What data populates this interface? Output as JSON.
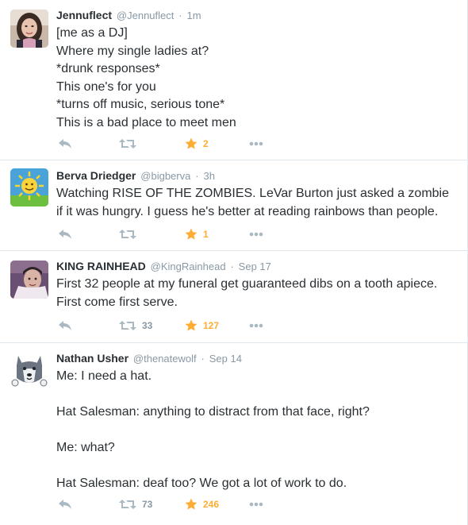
{
  "colors": {
    "text": "#292f33",
    "muted": "#8899a6",
    "favorite": "#ffac33",
    "divider": "#e1e8ed"
  },
  "tweets": [
    {
      "fullname": "Jennuflect",
      "username": "@Jennuflect",
      "time": "1m",
      "lines": [
        "[me as a DJ]",
        "Where my single ladies at?",
        "*drunk responses*",
        "This one's for you",
        "*turns off music, serious tone*",
        "This is a bad place to meet men"
      ],
      "retweets": "",
      "favorites": "2",
      "avatar_icon": "woman-avatar-icon"
    },
    {
      "fullname": "Berva Driedger",
      "username": "@bigberva",
      "time": "3h",
      "lines": [
        "Watching RISE OF THE ZOMBIES. LeVar Burton just asked a zombie",
        "if it was hungry. I guess he's better at reading rainbows than people."
      ],
      "retweets": "",
      "favorites": "1",
      "avatar_icon": "sun-avatar-icon"
    },
    {
      "fullname": "KING RAINHEAD",
      "username": "@KingRainhead",
      "time": "Sep 17",
      "lines": [
        "First 32 people at my funeral get guaranteed dibs on a tooth apiece.",
        "First come first serve."
      ],
      "retweets": "33",
      "favorites": "127",
      "avatar_icon": "man-avatar-icon"
    },
    {
      "fullname": "Nathan Usher",
      "username": "@thenatewolf",
      "time": "Sep 14",
      "lines": [
        "Me: I need a hat.",
        "",
        "Hat Salesman: anything to distract from that face, right?",
        "",
        "Me: what?",
        "",
        "Hat Salesman: deaf too? We got a lot of work to do."
      ],
      "retweets": "73",
      "favorites": "246",
      "avatar_icon": "wolf-avatar-icon"
    }
  ]
}
